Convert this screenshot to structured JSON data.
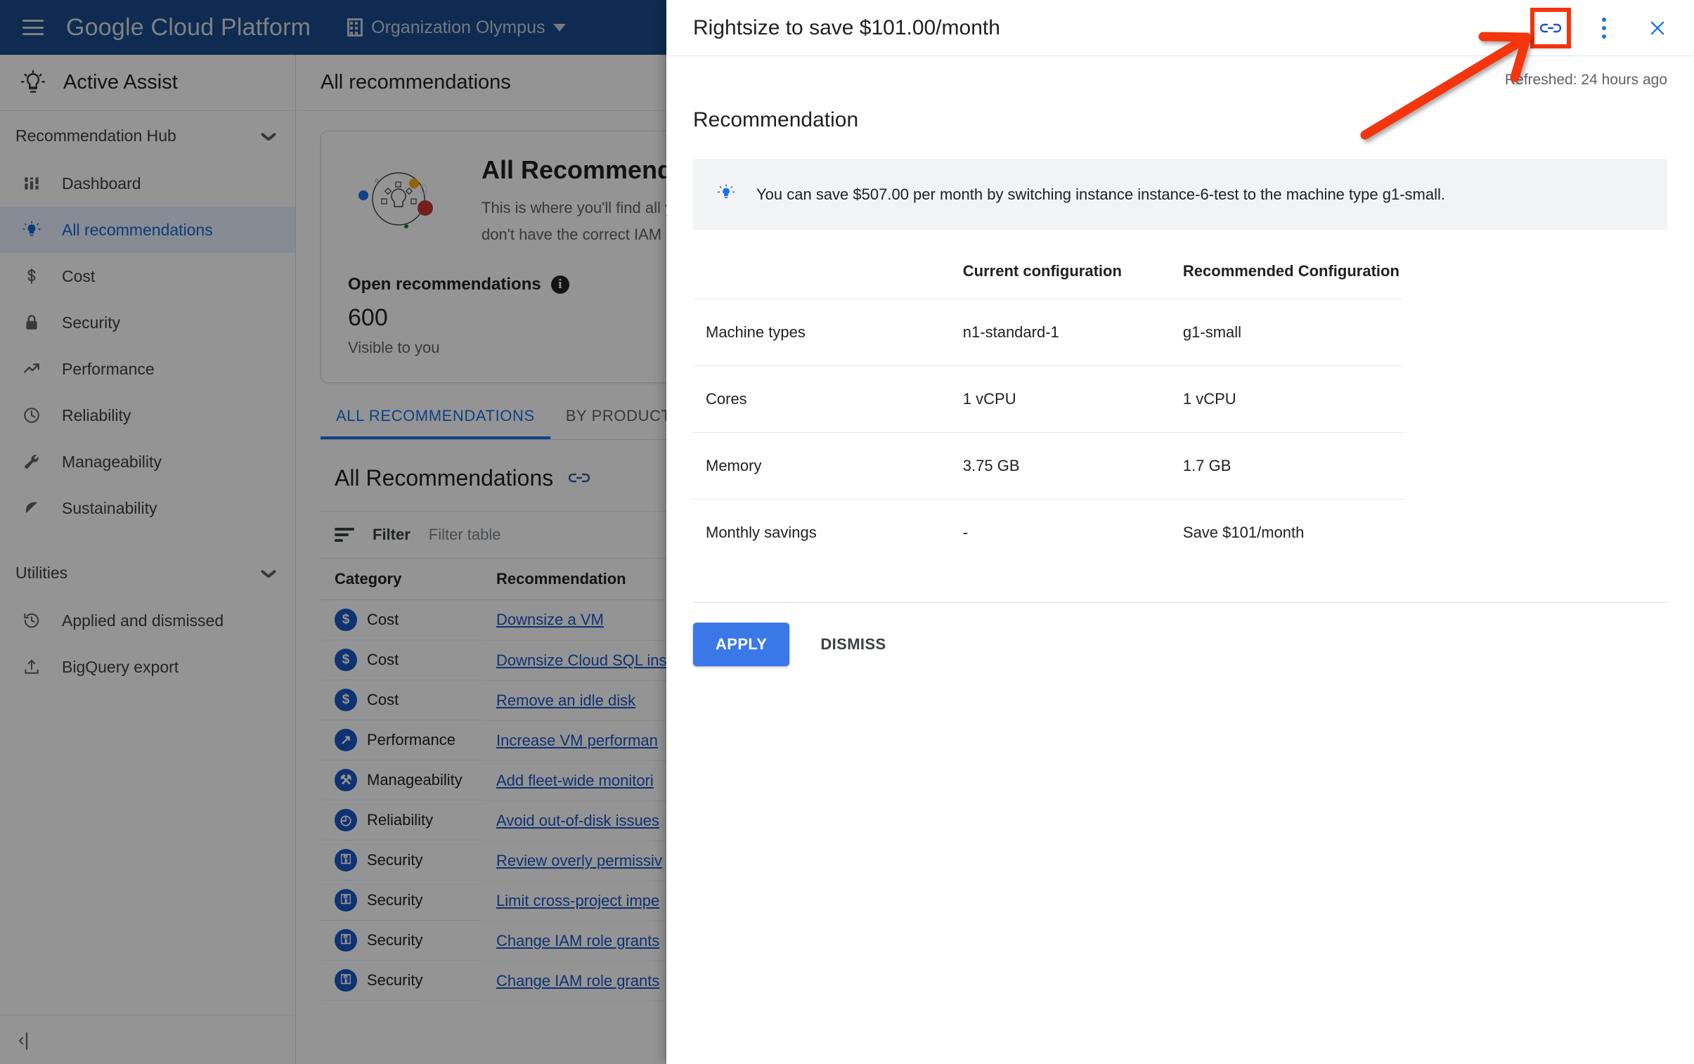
{
  "topbar": {
    "brand": "Google Cloud Platform",
    "org_selector": "Organization Olympus",
    "menu_icon": "hamburger-icon",
    "org_icon": "building-icon"
  },
  "sidebar": {
    "product_title": "Active Assist",
    "groups": [
      {
        "label": "Recommendation Hub",
        "items": [
          {
            "label": "Dashboard",
            "icon": "dashboard-icon",
            "active": false
          },
          {
            "label": "All recommendations",
            "icon": "bulb-icon",
            "active": true
          },
          {
            "label": "Cost",
            "icon": "dollar-icon",
            "active": false
          },
          {
            "label": "Security",
            "icon": "lock-icon",
            "active": false
          },
          {
            "label": "Performance",
            "icon": "trending-up-icon",
            "active": false
          },
          {
            "label": "Reliability",
            "icon": "clock-icon",
            "active": false
          },
          {
            "label": "Manageability",
            "icon": "wrench-icon",
            "active": false
          },
          {
            "label": "Sustainability",
            "icon": "leaf-icon",
            "active": false
          }
        ]
      },
      {
        "label": "Utilities",
        "items": [
          {
            "label": "Applied and dismissed",
            "icon": "history-icon",
            "active": false
          },
          {
            "label": "BigQuery export",
            "icon": "upload-icon",
            "active": false
          }
        ]
      }
    ],
    "collapse_label": "‹|"
  },
  "content": {
    "header_title": "All recommendations",
    "hero": {
      "title": "All Recommendations",
      "description_line1": "This is where you'll find all your re",
      "description_line2": "don't have the correct IAM permis",
      "metric_label": "Open recommendations",
      "metric_value": "600",
      "metric_sub": "Visible to you",
      "info_glyph": "i"
    },
    "tabs": [
      {
        "label": "ALL RECOMMENDATIONS",
        "active": true
      },
      {
        "label": "BY PRODUCT",
        "active": false
      }
    ],
    "table_title": "All Recommendations",
    "table_link_icon": "link-icon",
    "filter": {
      "icon": "filter-icon",
      "label": "Filter",
      "placeholder": "Filter table"
    },
    "table": {
      "columns": [
        "Category",
        "Recommendation"
      ],
      "rows": [
        {
          "category": "Cost",
          "badge": "$",
          "recommendation": "Downsize a VM"
        },
        {
          "category": "Cost",
          "badge": "$",
          "recommendation": "Downsize Cloud SQL ins"
        },
        {
          "category": "Cost",
          "badge": "$",
          "recommendation": "Remove an idle disk"
        },
        {
          "category": "Performance",
          "badge": "↗",
          "recommendation": "Increase VM performan"
        },
        {
          "category": "Manageability",
          "badge": "⚒",
          "recommendation": "Add fleet-wide monitori"
        },
        {
          "category": "Reliability",
          "badge": "◴",
          "recommendation": "Avoid out-of-disk issues"
        },
        {
          "category": "Security",
          "badge": "⚿",
          "recommendation": "Review overly permissiv"
        },
        {
          "category": "Security",
          "badge": "⚿",
          "recommendation": "Limit cross-project impe"
        },
        {
          "category": "Security",
          "badge": "⚿",
          "recommendation": "Change IAM role grants"
        },
        {
          "category": "Security",
          "badge": "⚿",
          "recommendation": "Change IAM role grants"
        }
      ]
    }
  },
  "panel": {
    "title": "Rightsize to save $101.00/month",
    "actions": {
      "link_icon": "link-icon",
      "more_icon": "kebab-menu-icon",
      "close_icon": "close-icon"
    },
    "refreshed": "Refreshed: 24 hours ago",
    "section_title": "Recommendation",
    "callout": {
      "icon": "bulb-icon",
      "text": "You can save $507.00 per month by switching instance instance-6-test to the machine type g1-small."
    },
    "comparison": {
      "columns": [
        "",
        "Current configuration",
        "Recommended Configuration"
      ],
      "rows": [
        {
          "label": "Machine types",
          "current": "n1-standard-1",
          "recommended": "g1-small"
        },
        {
          "label": "Cores",
          "current": "1 vCPU",
          "recommended": "1 vCPU"
        },
        {
          "label": "Memory",
          "current": "3.75 GB",
          "recommended": "1.7 GB"
        },
        {
          "label": "Monthly savings",
          "current": "-",
          "recommended": "Save $101/month"
        }
      ]
    },
    "footer": {
      "apply_label": "APPLY",
      "dismiss_label": "DISMISS"
    }
  },
  "annotation": {
    "type": "arrow-and-box",
    "color": "#f4340c",
    "target": "link-icon"
  },
  "colors": {
    "topbar_blue": "#1a4b8c",
    "accent_blue": "#1a73e8",
    "primary_button": "#3b78e7",
    "annotation_red": "#f4340c",
    "selected_nav_bg": "#e8f0fe"
  }
}
